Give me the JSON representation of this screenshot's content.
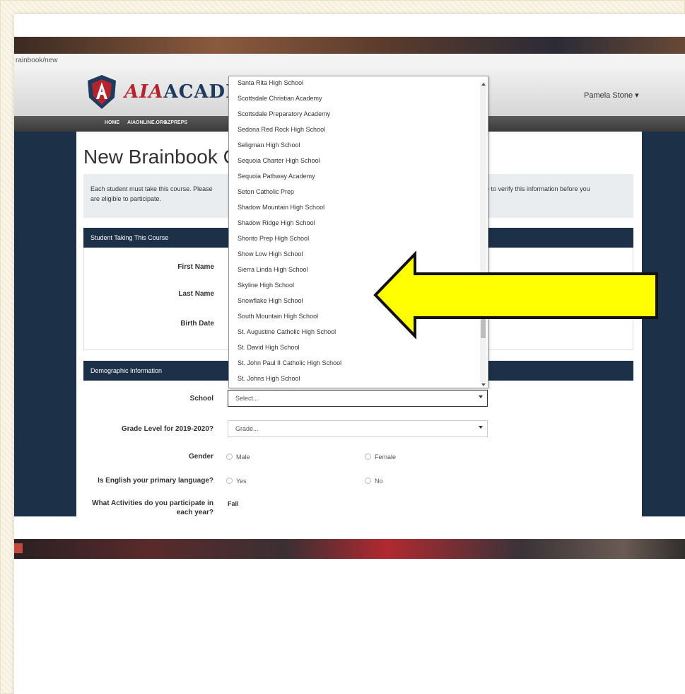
{
  "browser": {
    "url_fragment": "rainbook/new"
  },
  "header": {
    "logo_part1": "AIA",
    "logo_part2": "ACADEMY",
    "user_name": "Pamela Stone ▾"
  },
  "nav": {
    "items": [
      "HOME",
      "AIAONLINE.ORG",
      "AZPREPS"
    ]
  },
  "page": {
    "title": "New Brainbook C",
    "notice_line1": "Each student must take this course. Please",
    "notice_line2": "are eligible to participate.",
    "notice_right": "ble to verify this information before you"
  },
  "student_panel": {
    "heading": "Student Taking This Course",
    "first_name_label": "First Name",
    "last_name_label": "Last Name",
    "birth_date_label": "Birth Date"
  },
  "demographic_panel": {
    "heading": "Demographic Information",
    "school_label": "School",
    "school_value": "Select...",
    "grade_label": "Grade Level for 2019-2020?",
    "grade_value": "Grade...",
    "gender_label": "Gender",
    "gender_options": [
      "Male",
      "Female"
    ],
    "english_label": "Is English your primary language?",
    "english_options": [
      "Yes",
      "No"
    ],
    "activities_label_line1": "What Activities do you participate in",
    "activities_label_line2": "each year?",
    "activities_season": "Fall"
  },
  "school_dropdown": {
    "options": [
      "Santa Rita High School",
      "Scottsdale Christian Academy",
      "Scottsdale Preparatory Academy",
      "Sedona Red Rock High School",
      "Seligman High School",
      "Sequoia Charter High School",
      "Sequoia Pathway Academy",
      "Seton Catholic Prep",
      "Shadow Mountain High School",
      "Shadow Ridge High School",
      "Shonto Prep High School",
      "Show Low High School",
      "Sierra Linda High School",
      "Skyline High School",
      "Snowflake High School",
      "South Mountain High School",
      "St. Augustine Catholic High School",
      "St. David High School",
      "St. John Paul II Catholic High School",
      "St. Johns High School"
    ]
  },
  "colors": {
    "navy": "#1c3148",
    "logo_red": "#b5232c",
    "arrow_yellow": "#ffff00"
  },
  "icons": {
    "arrow": "left-arrow-annotation-icon",
    "logo": "aia-shield-logo-icon"
  }
}
